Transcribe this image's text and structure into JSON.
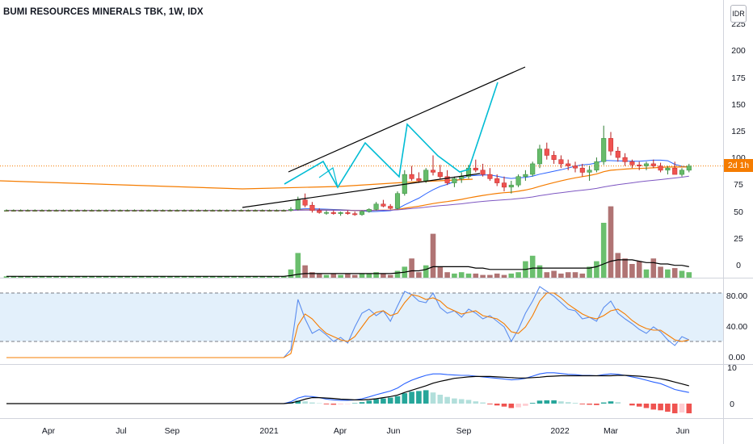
{
  "header": {
    "title": "BUMI RESOURCES MINERALS TBK, 1W, IDX",
    "currency": "IDR",
    "countdown": "2d 1h"
  },
  "colors": {
    "up": "#26a69a",
    "up_fill": "#66bb6a",
    "down": "#ef5350",
    "bar_up": "#6bbf6e",
    "bar_down": "#b07474",
    "pattern": "#00bcd4",
    "trend": "#000000",
    "ma_orange": "#f57c00",
    "ma_blue": "#2962ff",
    "stoch_k": "#5b8def",
    "stoch_d": "#f57c00",
    "band_fill": "#e3f0fb"
  },
  "chart_data": [
    {
      "type": "candlestick",
      "panel": "price",
      "y_ticks": [
        "225",
        "200",
        "175",
        "150",
        "125",
        "100",
        "75",
        "50",
        "25",
        "0"
      ],
      "ylim": [
        0,
        230
      ],
      "x_ticks": [
        "Apr",
        "Jul",
        "Sep",
        "2021",
        "Apr",
        "Jun",
        "Sep",
        "2022",
        "Mar",
        "Jun"
      ],
      "candles": [
        [
          52,
          53,
          51,
          52
        ],
        [
          52,
          53,
          51,
          52
        ],
        [
          52,
          53,
          51,
          52
        ],
        [
          52,
          53,
          51,
          52
        ],
        [
          52,
          53,
          51,
          52
        ],
        [
          52,
          53,
          51,
          52
        ],
        [
          52,
          53,
          51,
          52
        ],
        [
          52,
          53,
          51,
          52
        ],
        [
          52,
          53,
          51,
          52
        ],
        [
          52,
          53,
          51,
          52
        ],
        [
          52,
          53,
          51,
          52
        ],
        [
          52,
          53,
          51,
          52
        ],
        [
          52,
          53,
          51,
          52
        ],
        [
          52,
          53,
          51,
          52
        ],
        [
          52,
          53,
          51,
          52
        ],
        [
          52,
          53,
          51,
          52
        ],
        [
          52,
          53,
          51,
          52
        ],
        [
          52,
          53,
          51,
          52
        ],
        [
          52,
          53,
          51,
          52
        ],
        [
          52,
          53,
          51,
          52
        ],
        [
          52,
          53,
          51,
          52
        ],
        [
          52,
          53,
          51,
          52
        ],
        [
          52,
          53,
          51,
          52
        ],
        [
          52,
          53,
          51,
          52
        ],
        [
          52,
          53,
          51,
          52
        ],
        [
          52,
          53,
          51,
          52
        ],
        [
          52,
          53,
          51,
          52
        ],
        [
          52,
          53,
          51,
          52
        ],
        [
          52,
          53,
          51,
          52
        ],
        [
          52,
          53,
          51,
          52
        ],
        [
          52,
          53,
          51,
          52
        ],
        [
          52,
          53,
          51,
          52
        ],
        [
          52,
          53,
          51,
          52
        ],
        [
          52,
          53,
          51,
          52
        ],
        [
          52,
          53,
          51,
          52
        ],
        [
          52,
          53,
          51,
          52
        ],
        [
          52,
          53,
          51,
          52
        ],
        [
          52,
          53,
          51,
          52
        ],
        [
          52,
          53,
          51,
          52
        ],
        [
          52,
          53,
          51,
          52
        ],
        [
          52,
          55,
          51,
          53
        ],
        [
          53,
          65,
          52,
          62
        ],
        [
          62,
          68,
          55,
          57
        ],
        [
          57,
          60,
          50,
          52
        ],
        [
          52,
          54,
          49,
          50
        ],
        [
          50,
          52,
          48,
          50
        ],
        [
          50,
          52,
          48,
          49
        ],
        [
          49,
          51,
          47,
          50
        ],
        [
          50,
          52,
          48,
          49
        ],
        [
          49,
          51,
          47,
          48
        ],
        [
          48,
          52,
          47,
          51
        ],
        [
          51,
          54,
          50,
          53
        ],
        [
          53,
          60,
          52,
          58
        ],
        [
          58,
          62,
          55,
          56
        ],
        [
          56,
          58,
          53,
          54
        ],
        [
          54,
          70,
          53,
          68
        ],
        [
          68,
          90,
          66,
          86
        ],
        [
          86,
          94,
          80,
          82
        ],
        [
          82,
          88,
          78,
          80
        ],
        [
          80,
          92,
          78,
          90
        ],
        [
          90,
          104,
          85,
          88
        ],
        [
          88,
          95,
          82,
          84
        ],
        [
          84,
          90,
          76,
          78
        ],
        [
          78,
          84,
          74,
          82
        ],
        [
          82,
          88,
          78,
          84
        ],
        [
          84,
          95,
          82,
          92
        ],
        [
          92,
          100,
          88,
          90
        ],
        [
          90,
          96,
          84,
          86
        ],
        [
          86,
          92,
          80,
          82
        ],
        [
          82,
          86,
          75,
          78
        ],
        [
          78,
          84,
          70,
          74
        ],
        [
          74,
          80,
          68,
          76
        ],
        [
          76,
          86,
          74,
          84
        ],
        [
          84,
          90,
          80,
          86
        ],
        [
          86,
          98,
          84,
          96
        ],
        [
          96,
          114,
          92,
          110
        ],
        [
          110,
          116,
          100,
          104
        ],
        [
          104,
          108,
          96,
          100
        ],
        [
          100,
          104,
          92,
          96
        ],
        [
          96,
          100,
          90,
          94
        ],
        [
          94,
          98,
          88,
          92
        ],
        [
          92,
          96,
          84,
          88
        ],
        [
          88,
          94,
          80,
          90
        ],
        [
          90,
          102,
          88,
          98
        ],
        [
          98,
          132,
          95,
          120
        ],
        [
          120,
          126,
          104,
          108
        ],
        [
          108,
          112,
          98,
          102
        ],
        [
          102,
          106,
          94,
          98
        ],
        [
          98,
          100,
          92,
          95
        ],
        [
          95,
          98,
          90,
          94
        ],
        [
          94,
          98,
          90,
          96
        ],
        [
          96,
          100,
          92,
          94
        ],
        [
          94,
          97,
          88,
          90
        ],
        [
          90,
          94,
          86,
          92
        ],
        [
          92,
          98,
          88,
          86
        ],
        [
          86,
          92,
          84,
          90
        ],
        [
          90,
          96,
          88,
          94
        ]
      ]
    },
    {
      "type": "bar",
      "panel": "volume",
      "values": [
        1,
        1,
        1,
        1,
        1,
        1,
        1,
        1,
        1,
        1,
        1,
        1,
        1,
        1,
        1,
        1,
        1,
        1,
        1,
        1,
        1,
        1,
        1,
        1,
        1,
        1,
        1,
        1,
        1,
        1,
        1,
        1,
        1,
        1,
        1,
        1,
        1,
        1,
        1,
        1,
        6,
        18,
        9,
        4,
        3,
        2,
        3,
        2,
        3,
        2,
        3,
        3,
        4,
        3,
        2,
        5,
        8,
        14,
        4,
        9,
        32,
        8,
        4,
        3,
        4,
        3,
        3,
        2,
        2,
        3,
        2,
        3,
        4,
        12,
        16,
        9,
        4,
        5,
        3,
        4,
        4,
        3,
        8,
        12,
        40,
        52,
        18,
        14,
        10,
        12,
        6,
        14,
        8,
        6,
        7,
        5,
        4
      ],
      "ma": [
        1,
        1,
        1,
        1,
        1,
        1,
        1,
        1,
        1,
        1,
        1,
        1,
        1,
        1,
        1,
        1,
        1,
        1,
        1,
        1,
        1,
        1,
        1,
        1,
        1,
        1,
        1,
        1,
        1,
        1,
        1,
        1,
        1,
        1,
        1,
        1,
        1,
        1,
        1,
        1,
        1.5,
        2.5,
        3,
        3,
        3,
        3,
        3,
        3,
        3,
        3,
        3,
        3,
        3,
        3,
        3,
        3.5,
        4,
        5,
        5,
        6,
        8,
        8,
        8,
        8,
        8,
        8,
        7,
        7,
        6,
        6,
        6,
        6,
        6,
        6,
        7,
        7,
        7,
        7,
        7,
        7,
        7,
        7,
        7,
        8,
        10,
        12,
        13,
        13,
        13,
        12,
        11,
        11,
        10,
        10,
        9,
        9,
        8
      ]
    },
    {
      "type": "line",
      "panel": "stochastic",
      "y_ticks": [
        "80.00",
        "40.00",
        "0.00"
      ],
      "ylim": [
        0,
        100
      ],
      "band": [
        80,
        20
      ],
      "series": [
        {
          "values": [
            0,
            0,
            0,
            0,
            0,
            0,
            0,
            0,
            0,
            0,
            0,
            0,
            0,
            0,
            0,
            0,
            0,
            0,
            0,
            0,
            0,
            0,
            0,
            0,
            0,
            0,
            0,
            0,
            0,
            0,
            0,
            0,
            0,
            0,
            0,
            0,
            0,
            0,
            0,
            0,
            10,
            72,
            48,
            30,
            35,
            28,
            20,
            25,
            18,
            38,
            55,
            60,
            52,
            58,
            45,
            64,
            82,
            78,
            70,
            68,
            80,
            62,
            55,
            58,
            50,
            60,
            55,
            48,
            52,
            45,
            38,
            20,
            35,
            55,
            70,
            88,
            82,
            76,
            68,
            60,
            58,
            48,
            50,
            45,
            62,
            70,
            55,
            48,
            42,
            35,
            30,
            38,
            32,
            22,
            15,
            26,
            22
          ]
        },
        {
          "values": [
            0,
            0,
            0,
            0,
            0,
            0,
            0,
            0,
            0,
            0,
            0,
            0,
            0,
            0,
            0,
            0,
            0,
            0,
            0,
            0,
            0,
            0,
            0,
            0,
            0,
            0,
            0,
            0,
            0,
            0,
            0,
            0,
            0,
            0,
            0,
            0,
            0,
            0,
            0,
            0,
            5,
            40,
            54,
            48,
            38,
            30,
            26,
            22,
            20,
            26,
            38,
            50,
            56,
            58,
            52,
            55,
            68,
            78,
            76,
            72,
            74,
            70,
            62,
            58,
            54,
            56,
            58,
            52,
            50,
            48,
            42,
            32,
            30,
            38,
            52,
            70,
            80,
            80,
            74,
            66,
            60,
            54,
            50,
            48,
            52,
            58,
            60,
            54,
            46,
            40,
            36,
            34,
            34,
            28,
            22,
            20,
            22
          ]
        }
      ]
    },
    {
      "type": "bar",
      "panel": "macd",
      "y_ticks": [
        "10",
        "0"
      ],
      "ylim": [
        -4,
        11
      ],
      "histogram": [
        0,
        0,
        0,
        0,
        0,
        0,
        0,
        0,
        0,
        0,
        0,
        0,
        0,
        0,
        0,
        0,
        0,
        0,
        0,
        0,
        0,
        0,
        0,
        0,
        0,
        0,
        0,
        0,
        0,
        0,
        0,
        0,
        0,
        0,
        0,
        0,
        0,
        0,
        0,
        0,
        0.3,
        0.8,
        0.6,
        0.3,
        0.1,
        -0.2,
        -0.3,
        -0.2,
        -0.1,
        0.1,
        0.4,
        0.8,
        1.2,
        1.4,
        1.6,
        2,
        2.8,
        3.2,
        3.4,
        3.6,
        3,
        2.4,
        1.8,
        1.4,
        1.2,
        1,
        0.6,
        0.3,
        -0.2,
        -0.5,
        -0.8,
        -1.2,
        -1,
        -0.6,
        0.2,
        0.8,
        0.9,
        0.9,
        0.6,
        0.4,
        0.2,
        -0.2,
        -0.3,
        -0.4,
        0.3,
        0.6,
        0.4,
        0,
        -0.5,
        -0.8,
        -1.2,
        -1.6,
        -1.8,
        -2.2,
        -2.6,
        -2.4,
        -2.6
      ],
      "macd_line": [
        0,
        0,
        0,
        0,
        0,
        0,
        0,
        0,
        0,
        0,
        0,
        0,
        0,
        0,
        0,
        0,
        0,
        0,
        0,
        0,
        0,
        0,
        0,
        0,
        0,
        0,
        0,
        0,
        0,
        0,
        0,
        0,
        0,
        0,
        0,
        0,
        0,
        0,
        0,
        0,
        0.5,
        1.5,
        2,
        1.9,
        1.6,
        1.2,
        1,
        0.9,
        0.9,
        1,
        1.3,
        1.8,
        2.4,
        2.9,
        3.4,
        4.2,
        5.4,
        6.3,
        7,
        7.6,
        8,
        8,
        7.8,
        7.7,
        7.6,
        7.6,
        7.4,
        7.2,
        7,
        6.8,
        6.6,
        6.4,
        6.5,
        6.8,
        7.4,
        8,
        8.3,
        8.3,
        8.1,
        7.9,
        7.8,
        7.6,
        7.6,
        7.5,
        7.8,
        8,
        7.9,
        7.6,
        7.2,
        6.8,
        6.3,
        5.8,
        5.4,
        4.6,
        3.8,
        3.4,
        3
      ],
      "signal_line": [
        0,
        0,
        0,
        0,
        0,
        0,
        0,
        0,
        0,
        0,
        0,
        0,
        0,
        0,
        0,
        0,
        0,
        0,
        0,
        0,
        0,
        0,
        0,
        0,
        0,
        0,
        0,
        0,
        0,
        0,
        0,
        0,
        0,
        0,
        0,
        0,
        0,
        0,
        0,
        0,
        0.2,
        0.6,
        1.2,
        1.6,
        1.6,
        1.5,
        1.4,
        1.2,
        1.1,
        1,
        1,
        1.1,
        1.3,
        1.6,
        1.9,
        2.3,
        3,
        3.6,
        4.2,
        4.8,
        5.5,
        6,
        6.4,
        6.8,
        7,
        7.2,
        7.3,
        7.3,
        7.3,
        7.2,
        7.1,
        7,
        6.9,
        6.9,
        7,
        7.1,
        7.3,
        7.4,
        7.5,
        7.5,
        7.5,
        7.5,
        7.5,
        7.5,
        7.5,
        7.5,
        7.6,
        7.6,
        7.5,
        7.4,
        7.2,
        7,
        6.7,
        6.3,
        5.8,
        5.3,
        4.8
      ]
    }
  ]
}
